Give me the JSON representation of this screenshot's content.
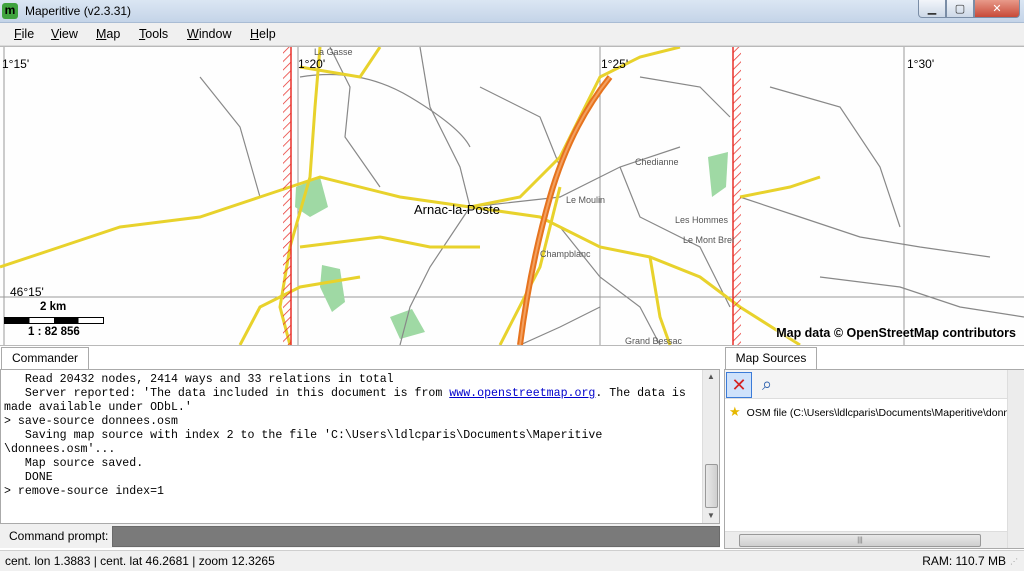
{
  "window": {
    "title": "Maperitive (v2.3.31)",
    "app_icon_letter": "m",
    "minimize": "▁",
    "maximize": "▢",
    "close": "✕"
  },
  "menu": [
    "File",
    "View",
    "Map",
    "Tools",
    "Window",
    "Help"
  ],
  "map": {
    "lon_labels": [
      "1°15'",
      "1°20'",
      "1°25'",
      "1°30'"
    ],
    "lat_label": "46°15'",
    "places": [
      "Arnac-la-Poste",
      "Le Moulin",
      "Les Hommes",
      "Le Mont Brel",
      "Chedianne",
      "Champblanc",
      "Grand Bessac",
      "La Gasse"
    ],
    "scale_distance": "2 km",
    "scale_ratio": "1 : 82 856",
    "attribution": "Map data © OpenStreetMap contributors"
  },
  "commander": {
    "tab_label": "Commander",
    "lines": [
      "   Read 20432 nodes, 2414 ways and 33 relations in total",
      "   Server reported: 'The data included in this document is from "
    ],
    "link": "www.openstreetmap.org",
    "line2_rest": ". The data is",
    "lines_after": [
      "made available under ODbL.'",
      "> save-source donnees.osm",
      "   Saving map source with index 2 to the file 'C:\\Users\\ldlcparis\\Documents\\Maperitive",
      "\\donnees.osm'...",
      "   Map source saved.",
      "   DONE",
      "> remove-source index=1"
    ],
    "prompt_label": "Command prompt:"
  },
  "sources": {
    "tab_label": "Map Sources",
    "remove_icon": "✕",
    "zoom_icon": "⌕",
    "items": [
      "OSM file (C:\\Users\\ldlcparis\\Documents\\Maperitive\\donnees.osm)"
    ]
  },
  "status": {
    "left": "cent. lon 1.3883 | cent. lat 46.2681 | zoom 12.3265",
    "right": "RAM: 110.7 MB"
  }
}
